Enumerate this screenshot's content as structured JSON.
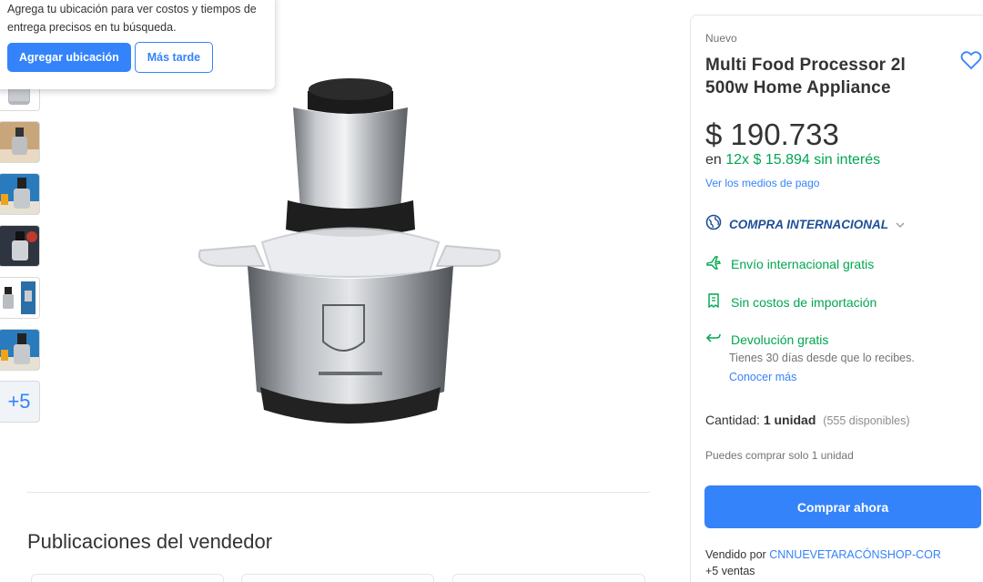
{
  "location_popup": {
    "message": "Agrega tu ubicación para ver costos y tiempos de entrega precisos en tu búsqueda.",
    "add_button": "Agregar ubicación",
    "later_button": "Más tarde"
  },
  "gallery": {
    "more_label": "+5"
  },
  "product": {
    "condition": "Nuevo",
    "title": "Multi Food Processor 2l 500w Home Appliance",
    "price": "$ 190.733",
    "installments_prefix": "en",
    "installments_amount": "12x $ 15.894 sin interés",
    "payment_link": "Ver los medios de pago"
  },
  "purchase_info": {
    "international_label": "COMPRA INTERNACIONAL",
    "shipping": "Envío internacional gratis",
    "import_costs": "Sin costos de importación",
    "returns": "Devolución gratis",
    "returns_detail": "Tienes 30 días desde que lo recibes.",
    "returns_link": "Conocer más"
  },
  "quantity": {
    "label": "Cantidad:",
    "value": "1 unidad",
    "available": "(555 disponibles)",
    "limit_note": "Puedes comprar solo 1 unidad"
  },
  "buy_button": "Comprar ahora",
  "seller": {
    "prefix": "Vendido por",
    "name": "CNNUEVETARACÓNSHOP-COR",
    "sales": "+5 ventas"
  },
  "seller_publications_title": "Publicaciones del vendedor",
  "colors": {
    "accent": "#3483fa",
    "success": "#00a650",
    "international": "#1f4e96"
  }
}
